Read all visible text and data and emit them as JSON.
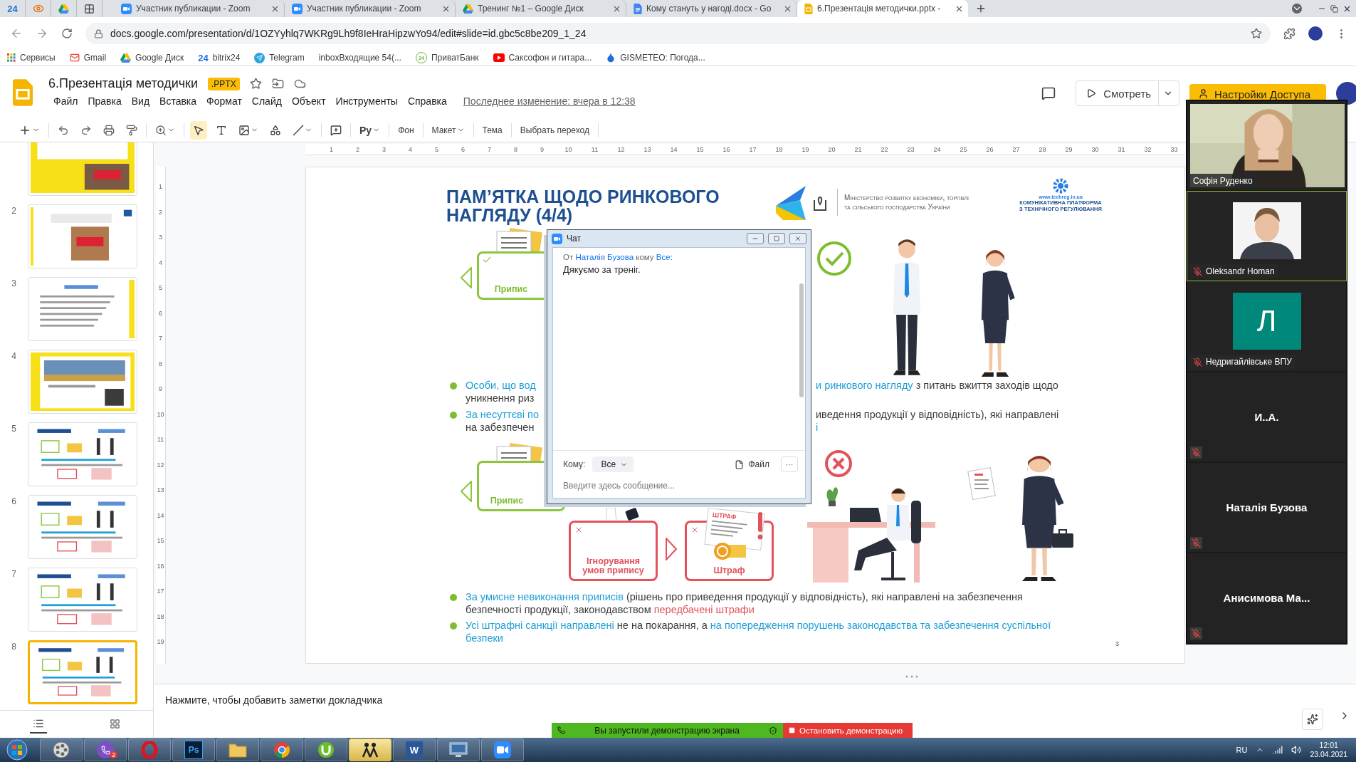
{
  "browser": {
    "pinned_tabs": [
      {
        "kind": "bitrix",
        "icon_text": "24"
      },
      {
        "kind": "eye"
      },
      {
        "kind": "drive"
      },
      {
        "kind": "grid"
      }
    ],
    "tabs": [
      {
        "title": "Участник публикации - Zoom",
        "kind": "zoom",
        "selected": false
      },
      {
        "title": "Участник публикации - Zoom",
        "kind": "zoom",
        "selected": false
      },
      {
        "title": "Тренинг №1 – Google Диск",
        "kind": "drive",
        "selected": false
      },
      {
        "title": "Кому стануть у нагоді.docx - Go",
        "kind": "docs",
        "selected": false
      },
      {
        "title": "6.Презентація методички.pptx -",
        "kind": "slides",
        "selected": true
      }
    ],
    "url": "docs.google.com/presentation/d/1OZYyhlq7WKRg9Lh9f8IeHraHipzwYo94/edit#slide=id.gbc5c8be209_1_24",
    "bookmarks": [
      {
        "label": "Сервисы",
        "kind": "apps"
      },
      {
        "label": "Gmail",
        "kind": "gmail"
      },
      {
        "label": "Google Диск",
        "kind": "drive"
      },
      {
        "label": "bitrix24",
        "kind": "bitrix",
        "icon_text": "24"
      },
      {
        "label": "Telegram",
        "kind": "telegram"
      },
      {
        "label": "inboxВходящие 54(...",
        "kind": "plain"
      },
      {
        "label": "ПриватБанк",
        "kind": "privat",
        "icon_text": "24"
      },
      {
        "label": "Саксофон и гитара...",
        "kind": "youtube"
      },
      {
        "label": "GISMETEO: Погода...",
        "kind": "drop"
      }
    ]
  },
  "docs": {
    "title": "6.Презентація методички",
    "badge": ".PPTX",
    "menu": [
      "Файл",
      "Правка",
      "Вид",
      "Вставка",
      "Формат",
      "Слайд",
      "Объект",
      "Инструменты",
      "Справка"
    ],
    "last_edit": "Последнее изменение: вчера в 12:38",
    "present_button": "Смотреть",
    "share_button": "Настройки Доступа",
    "input_tools": "Ру",
    "text_buttons": [
      {
        "label": "Фон",
        "dropdown": false
      },
      {
        "label": "Макет",
        "dropdown": true
      },
      {
        "label": "Тема",
        "dropdown": false
      },
      {
        "label": "Выбрать переход",
        "dropdown": false
      }
    ],
    "notes_placeholder": "Нажмите, чтобы добавить заметки докладчика"
  },
  "rulers": {
    "horizontal": [
      "1",
      "2",
      "3",
      "4",
      "5",
      "6",
      "7",
      "8",
      "9",
      "10",
      "11",
      "12",
      "13",
      "14",
      "15",
      "16",
      "17",
      "18",
      "19",
      "20",
      "21",
      "22",
      "23",
      "24",
      "25",
      "26",
      "27",
      "28",
      "29",
      "30",
      "31",
      "32",
      "33"
    ],
    "vertical": [
      "1",
      "2",
      "3",
      "4",
      "5",
      "6",
      "7",
      "8",
      "9",
      "10",
      "11",
      "12",
      "13",
      "14",
      "15",
      "16",
      "17",
      "18",
      "19"
    ]
  },
  "filmstrip": [
    {
      "kind": "yellow",
      "selected": false
    },
    {
      "number": "2",
      "kind": "shop",
      "selected": false
    },
    {
      "number": "3",
      "kind": "text",
      "selected": false
    },
    {
      "number": "4",
      "selected": false
    },
    {
      "number": "5",
      "kind": "diagram",
      "selected": false
    },
    {
      "number": "6",
      "kind": "diagram",
      "selected": false
    },
    {
      "number": "7",
      "kind": "diagram",
      "selected": false
    },
    {
      "number": "8",
      "kind": "diagram",
      "selected": true
    }
  ],
  "slide": {
    "title_lines": [
      "ПАМ’ЯТКА ЩОДО РИНКОВОГО",
      "НАГЛЯДУ (4/4)"
    ],
    "ministry_lines": [
      "Міністерство розвитку економіки, торгівлі",
      "та сільського господарства України"
    ],
    "platform": {
      "url": "www.techreg.in.ua",
      "lines": [
        "КОМУНІКАТИВНА ПЛАТФОРМА",
        "З ТЕХНІЧНОГО РЕГУЛЮВАННЯ"
      ]
    },
    "labels": {
      "order_top": "Припис",
      "order_bottom": "Припис",
      "ignore": "Ігнорування умов припису",
      "fine": "Штраф",
      "fine_document": "ШТРАФ"
    },
    "partial_bullets": [
      {
        "left_lines": [
          [
            {
              "kind": "blue",
              "text": "Особи, що вод"
            }
          ],
          [
            {
              "kind": "plain",
              "text": "уникнення риз"
            }
          ]
        ],
        "right_lines": [
          [
            {
              "kind": "blue",
              "text": "и ринкового нагляду"
            },
            {
              "kind": "plain",
              "text": " з питань вжиття заходів щодо"
            }
          ]
        ]
      },
      {
        "left_lines": [
          [
            {
              "kind": "blue",
              "text": "За несуттєві по"
            }
          ],
          [
            {
              "kind": "plain",
              "text": "на забезпечен"
            }
          ]
        ],
        "right_lines": [
          [
            {
              "kind": "plain",
              "text": "иведення продукції у відповідність), які направлені"
            }
          ],
          [
            {
              "kind": "blue",
              "text": "і"
            }
          ]
        ]
      }
    ],
    "bullets": [
      [
        {
          "kind": "blue",
          "text": "За умисне невиконання приписів"
        },
        {
          "kind": "plain",
          "text": " (рішень про приведення продукції у відповідність), які направлені на забезпечення безпечності продукції, законодавством "
        },
        {
          "kind": "red",
          "text": "передбачені штрафи"
        }
      ],
      [
        {
          "kind": "blue",
          "text": "Усі штрафні санкції направлені"
        },
        {
          "kind": "plain",
          "text": " не на покарання, а "
        },
        {
          "kind": "blue",
          "text": "на попередження порушень законодавства та забезпечення суспільної безпеки"
        }
      ]
    ],
    "page_number": "3"
  },
  "chat": {
    "title": "Чат",
    "from_label": "От",
    "sender": "Наталія Бузова",
    "to_label": "кому",
    "recipient": "Все:",
    "message": "Дякуємо за треніг.",
    "to_field_label": "Кому:",
    "to_value": "Все",
    "file_button": "Файл",
    "more_button": "···",
    "placeholder": "Введите здесь сообщение..."
  },
  "participants": [
    {
      "name": "Софія Руденко",
      "kind": "video",
      "muted": false,
      "highlighted": false
    },
    {
      "name": "Oleksandr Homan",
      "muted": true,
      "highlighted": true
    },
    {
      "name": "Недригайлівське ВПУ",
      "kind": "avatar",
      "avatar_letter": "Л",
      "muted": true,
      "highlighted": false
    },
    {
      "name": "И..А.",
      "kind": "name",
      "muted": true,
      "highlighted": false
    },
    {
      "name": "Наталія Бузова",
      "kind": "name",
      "muted": true,
      "highlighted": false
    },
    {
      "name": "Анисимова Ма...",
      "kind": "name",
      "muted": true,
      "highlighted": false
    }
  ],
  "share_banner": {
    "message": "Вы запустили демонстрацию экрана",
    "stop_button": "Остановить демонстрацию"
  },
  "taskbar": {
    "apps": [
      {
        "kind": "media",
        "active": false
      },
      {
        "kind": "viber",
        "badge": "2",
        "active": false
      },
      {
        "kind": "opera",
        "active": false
      },
      {
        "kind": "photoshop",
        "icon_text": "Ps",
        "active": false
      },
      {
        "kind": "explorer",
        "active": false
      },
      {
        "kind": "chrome",
        "active": false
      },
      {
        "kind": "utorrent",
        "active": false
      },
      {
        "kind": "app",
        "active": true
      },
      {
        "kind": "word",
        "icon_text": "W",
        "active": false
      },
      {
        "kind": "screen",
        "active": false
      },
      {
        "kind": "zoom",
        "active": false
      }
    ],
    "language": "RU",
    "time": "12:01",
    "date": "23.04.2021"
  }
}
